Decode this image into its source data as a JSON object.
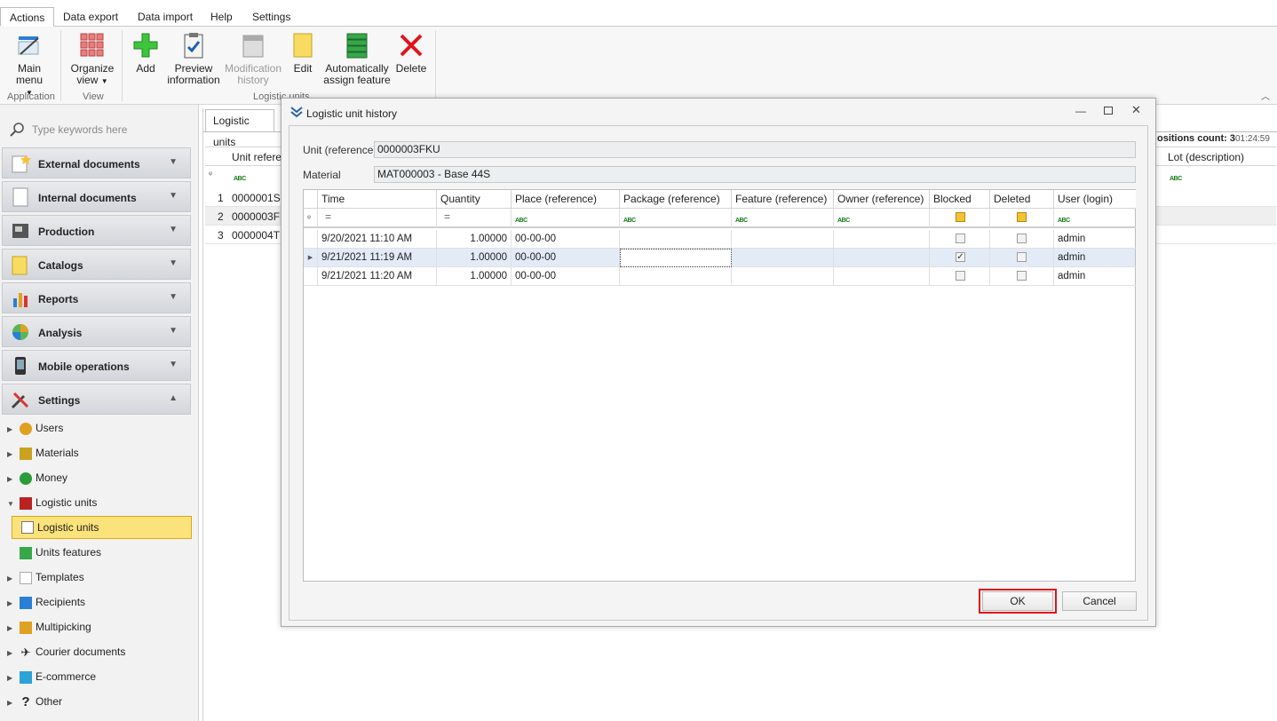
{
  "ribbon": {
    "tabs": [
      "Actions",
      "Data export",
      "Data import",
      "Help",
      "Settings"
    ],
    "buttons": {
      "main_menu": "Main menu",
      "organize_view_1": "Organize",
      "organize_view_2": "view",
      "add": "Add",
      "preview_1": "Preview",
      "preview_2": "information",
      "history_1": "Modification",
      "history_2": "history",
      "edit": "Edit",
      "auto_1": "Automatically",
      "auto_2": "assign feature",
      "delete": "Delete"
    },
    "groups": {
      "application": "Application",
      "view": "View",
      "logistic_units": "Logistic units"
    }
  },
  "sidebar": {
    "search_placeholder": "Type keywords here",
    "sections": [
      "External documents",
      "Internal documents",
      "Production",
      "Catalogs",
      "Reports",
      "Analysis",
      "Mobile operations",
      "Settings"
    ],
    "tree": [
      "Users",
      "Materials",
      "Money",
      "Logistic units",
      "Logistic units",
      "Units features",
      "Templates",
      "Recipients",
      "Multipicking",
      "Courier documents",
      "E-commerce",
      "Other"
    ]
  },
  "main": {
    "tab": "Logistic units",
    "positions_count": "ositions count: 3",
    "time": "01:24:59",
    "col_unit": "Unit referen",
    "col_lot": "Lot (description)",
    "rows": [
      {
        "n": "1",
        "ref": "0000001SQ"
      },
      {
        "n": "2",
        "ref": "0000003FK"
      },
      {
        "n": "3",
        "ref": "0000004TM"
      }
    ]
  },
  "dialog": {
    "title": "Logistic unit history",
    "unit_label": "Unit (reference)",
    "unit_value": "0000003FKU",
    "material_label": "Material",
    "material_value": "MAT000003 - Base 44S",
    "columns": [
      "Time",
      "Quantity",
      "Place (reference)",
      "Package (reference)",
      "Feature (reference)",
      "Owner (reference)",
      "Blocked",
      "Deleted",
      "User (login)"
    ],
    "filter_eq": "=",
    "filter_abc": "ABC",
    "rows": [
      {
        "time": "9/20/2021 11:10 AM",
        "qty": "1.00000",
        "place": "00-00-00",
        "user": "admin",
        "blocked": false,
        "deleted": false
      },
      {
        "time": "9/21/2021 11:19 AM",
        "qty": "1.00000",
        "place": "00-00-00",
        "user": "admin",
        "blocked": true,
        "deleted": false
      },
      {
        "time": "9/21/2021 11:20 AM",
        "qty": "1.00000",
        "place": "00-00-00",
        "user": "admin",
        "blocked": false,
        "deleted": false
      }
    ],
    "ok": "OK",
    "cancel": "Cancel",
    "check_mark": "✓"
  },
  "colors": {
    "accent_red": "#e0151b",
    "selection": "#fbe27a",
    "selected_row": "#e3ebf7"
  }
}
